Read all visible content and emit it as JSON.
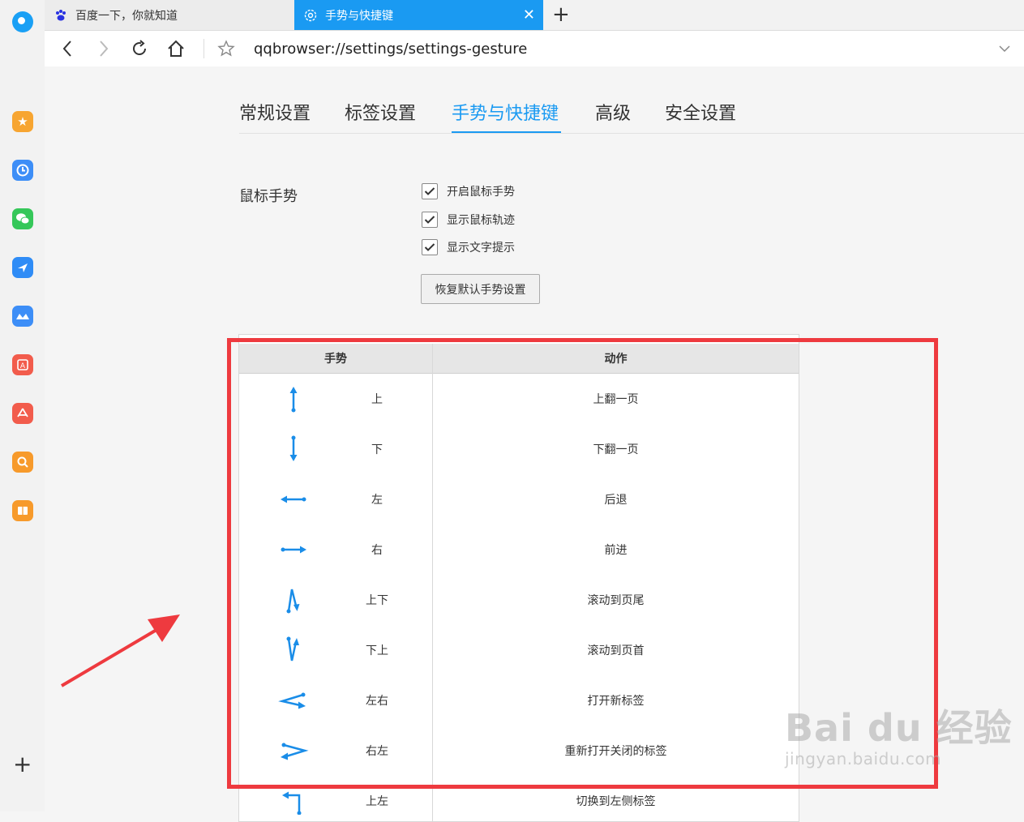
{
  "browser": {
    "tabs": [
      {
        "title": "百度一下，你就知道",
        "favicon": "baidu-paw-icon"
      },
      {
        "title": "手势与快捷键",
        "favicon": "settings-gear-icon",
        "active": true
      }
    ],
    "address": "qqbrowser://settings/settings-gesture"
  },
  "sidebar": {
    "items": [
      {
        "icon": "star-icon",
        "color": "#f7a531"
      },
      {
        "icon": "clock-icon",
        "color": "#3d8ef7"
      },
      {
        "icon": "wechat-icon",
        "color": "#35c759"
      },
      {
        "icon": "send-icon",
        "color": "#2f8cf6"
      },
      {
        "icon": "cloud-drive-icon",
        "color": "#3d8ef7"
      },
      {
        "icon": "translate-icon",
        "color": "#f25c4c"
      },
      {
        "icon": "pdf-icon",
        "color": "#f25c4c"
      },
      {
        "icon": "search-icon",
        "color": "#f79a2b"
      },
      {
        "icon": "book-icon",
        "color": "#f79a2b"
      }
    ]
  },
  "settings": {
    "tabs": [
      {
        "label": "常规设置"
      },
      {
        "label": "标签设置"
      },
      {
        "label": "手势与快捷键",
        "active": true
      },
      {
        "label": "高级"
      },
      {
        "label": "安全设置"
      }
    ],
    "mouse_gesture": {
      "label": "鼠标手势",
      "options": [
        {
          "label": "开启鼠标手势",
          "checked": true
        },
        {
          "label": "显示鼠标轨迹",
          "checked": true
        },
        {
          "label": "显示文字提示",
          "checked": true
        }
      ],
      "reset_label": "恢复默认手势设置"
    },
    "table": {
      "headers": {
        "gesture": "手势",
        "action": "动作"
      },
      "rows": [
        {
          "gesture": "上",
          "action": "上翻一页",
          "icon": "arrow-up-icon"
        },
        {
          "gesture": "下",
          "action": "下翻一页",
          "icon": "arrow-down-icon"
        },
        {
          "gesture": "左",
          "action": "后退",
          "icon": "arrow-left-icon"
        },
        {
          "gesture": "右",
          "action": "前进",
          "icon": "arrow-right-icon"
        },
        {
          "gesture": "上下",
          "action": "滚动到页尾",
          "icon": "up-down-gesture-icon"
        },
        {
          "gesture": "下上",
          "action": "滚动到页首",
          "icon": "down-up-gesture-icon"
        },
        {
          "gesture": "左右",
          "action": "打开新标签",
          "icon": "left-right-gesture-icon"
        },
        {
          "gesture": "右左",
          "action": "重新打开关闭的标签",
          "icon": "right-left-gesture-icon"
        },
        {
          "gesture": "上左",
          "action": "切换到左侧标签",
          "icon": "up-left-gesture-icon"
        }
      ]
    }
  },
  "watermark": {
    "line1": "Bai du 经验",
    "line2": "jingyan.baidu.com"
  },
  "accent_color": "#1a9af2",
  "annotation_color": "#ee3a3f"
}
